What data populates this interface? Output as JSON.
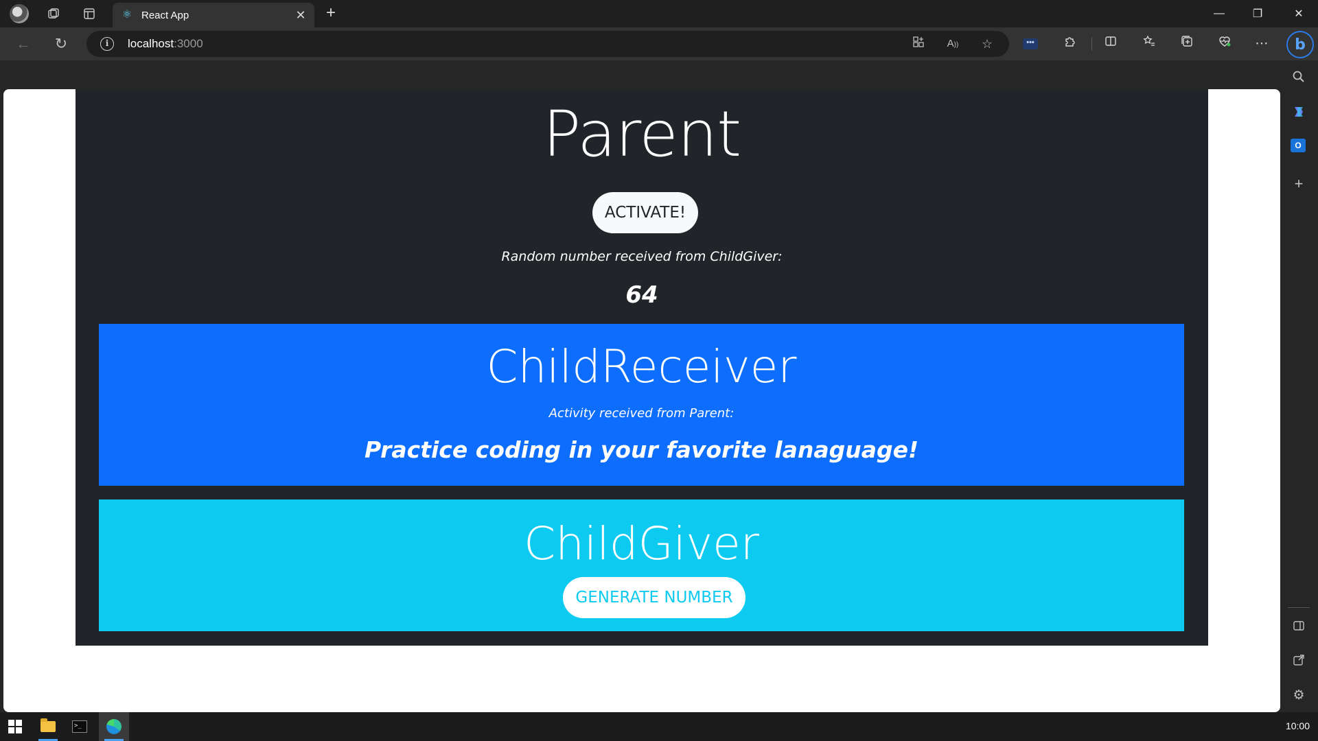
{
  "browser": {
    "tab": {
      "title": "React App",
      "favicon": "react-icon"
    },
    "address_bar": {
      "host": "localhost",
      "port": ":3000"
    },
    "icons": {
      "back": "←",
      "refresh": "↻",
      "info": "i",
      "new_tab": "+",
      "tab_close": "✕",
      "minimize": "—",
      "restore": "❐",
      "close": "✕",
      "more": "⋯"
    }
  },
  "page": {
    "parent": {
      "title": "Parent",
      "activate_button": "ACTIVATE!",
      "random_label": "Random number received from ChildGiver:",
      "random_value": "64"
    },
    "child_receiver": {
      "title": "ChildReceiver",
      "activity_label": "Activity received from Parent:",
      "activity_value": "Practice coding in your favorite lanaguage!"
    },
    "child_giver": {
      "title": "ChildGiver",
      "generate_button": "GENERATE NUMBER"
    }
  },
  "taskbar": {
    "clock": "10:00"
  },
  "colors": {
    "app_background": "#212529",
    "receiver_background": "#0d6efd",
    "giver_background": "#0dcaf0",
    "button_light": "#f8f9fa"
  }
}
